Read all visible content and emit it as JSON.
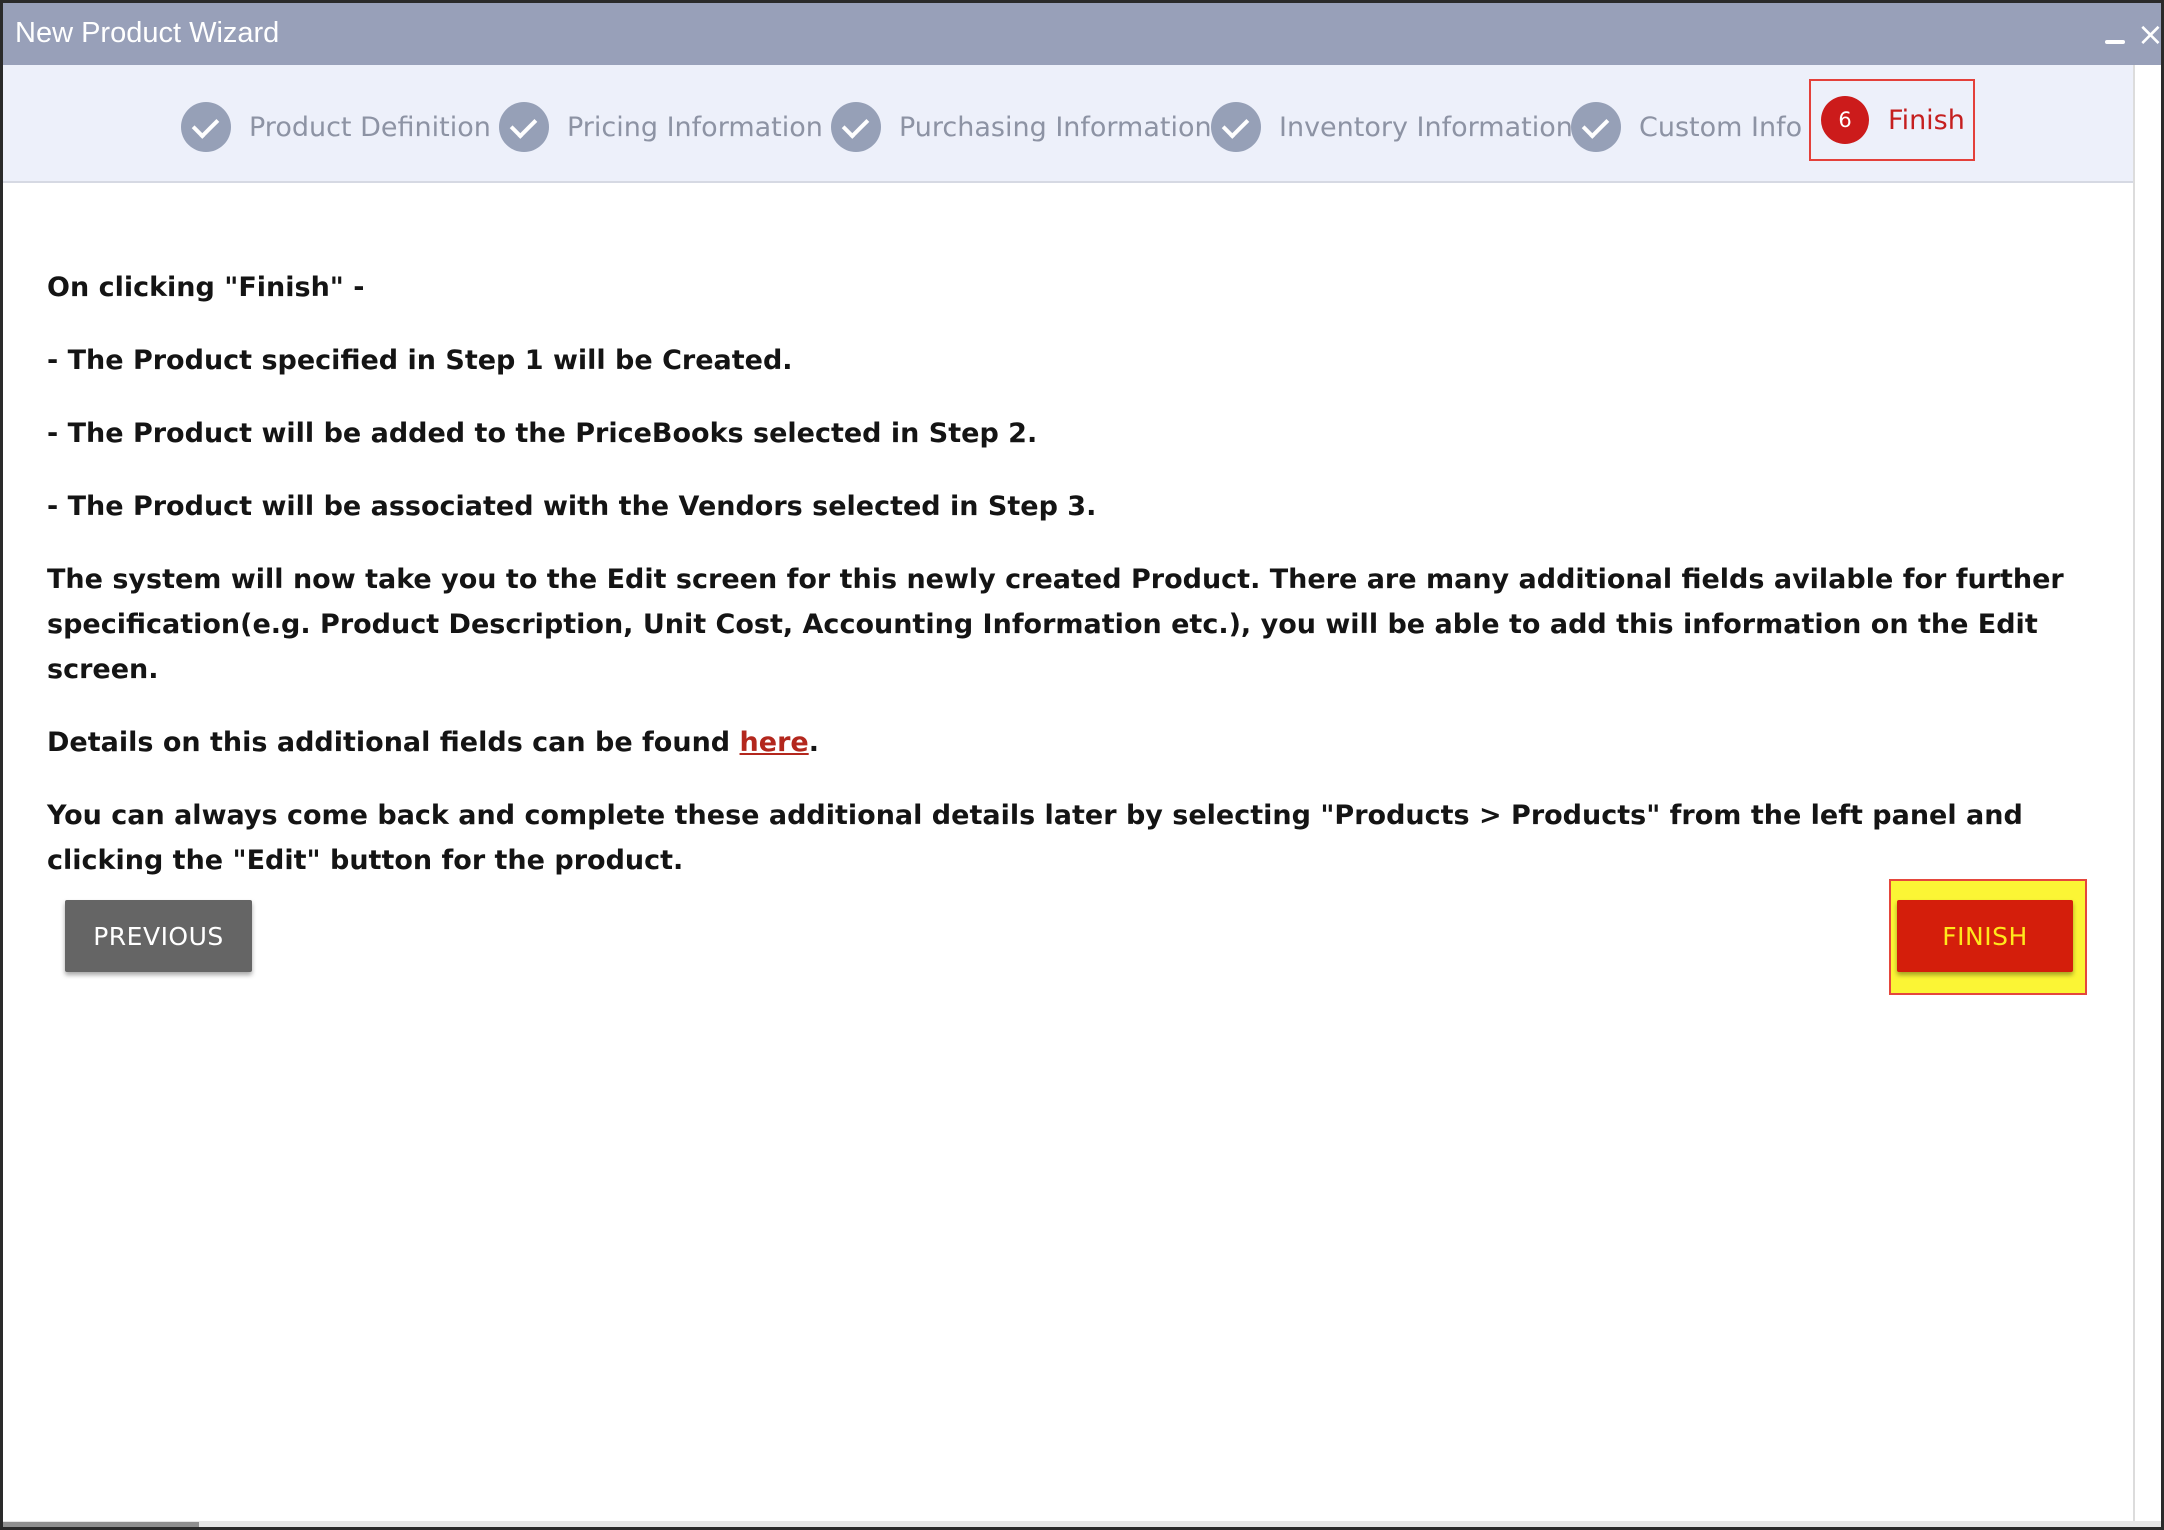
{
  "window": {
    "title": "New Product Wizard",
    "minimize_icon": "minimize-icon",
    "close_icon": "close-icon",
    "close_glyph": "×"
  },
  "steps": [
    {
      "label": "Product Definition",
      "status": "completed",
      "icon": "check-icon"
    },
    {
      "label": "Pricing Information",
      "status": "completed",
      "icon": "check-icon"
    },
    {
      "label": "Purchasing Information",
      "status": "completed",
      "icon": "check-icon"
    },
    {
      "label": "Inventory Information",
      "status": "completed",
      "icon": "check-icon"
    },
    {
      "label": "Custom Info",
      "status": "completed",
      "icon": "check-icon"
    },
    {
      "label": "Finish",
      "status": "active",
      "number": "6"
    }
  ],
  "content": {
    "intro": "On clicking \"Finish\" -",
    "line1": "- The Product specified in Step 1 will be Created.",
    "line2": "- The Product will be added to the PriceBooks selected in Step 2.",
    "line3": "- The Product will be associated with the Vendors selected in Step 3.",
    "paragraph": "The system will now take you to the Edit screen for this newly created Product. There are many additional fields avilable for further specification(e.g. Product Description, Unit Cost, Accounting Information etc.), you will be able to add this information on the Edit screen.",
    "details_prefix": "Details on this additional fields can be found ",
    "details_link": "here",
    "details_suffix": ".",
    "closing": "You can always come back and complete these additional details later by selecting \"Products > Products\" from the left panel and clicking the \"Edit\" button for the product."
  },
  "buttons": {
    "previous": "PREVIOUS",
    "finish": "FINISH"
  },
  "colors": {
    "titlebar": "#98a0b9",
    "stepper_bg": "#edf0fa",
    "active_step": "#cc1b1b",
    "finish_button": "#d41e0b",
    "finish_text": "#ffe81c",
    "highlight": "#fbf535",
    "previous_button": "#656565"
  }
}
